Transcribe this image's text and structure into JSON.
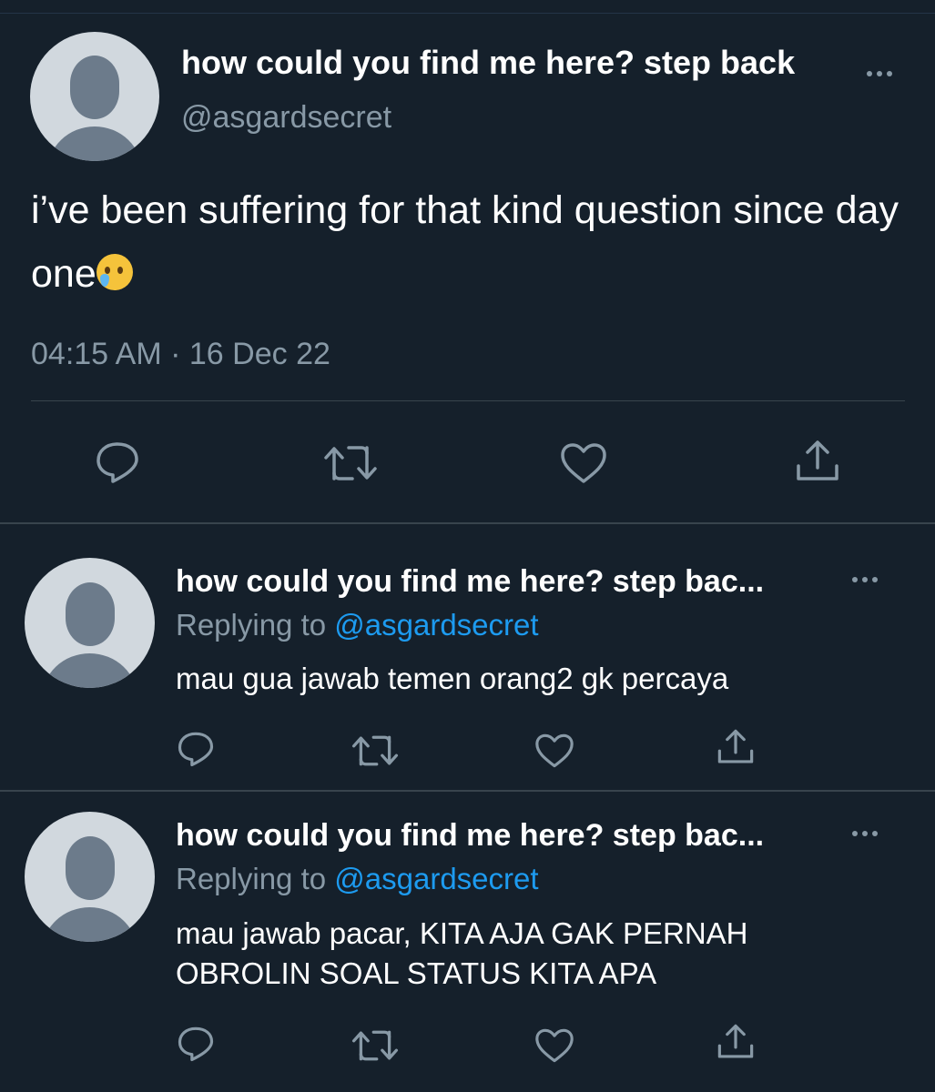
{
  "main_tweet": {
    "display_name": "how could you find me here? step back",
    "handle": "@asgardsecret",
    "text": "i’ve been suffering for that kind question since day one",
    "emoji_icon": "crying-face-emoji",
    "time": "04:15 AM",
    "separator": "·",
    "date": "16 Dec 22",
    "actions": [
      "reply-icon",
      "retweet-icon",
      "like-icon",
      "share-icon"
    ]
  },
  "replies": [
    {
      "display_name": "how could you find me here? step bac...",
      "replying_label": "Replying to",
      "replying_handle": "@asgardsecret",
      "text": "mau gua jawab temen orang2 gk percaya"
    },
    {
      "display_name": "how could you find me here? step bac...",
      "replying_label": "Replying to",
      "replying_handle": "@asgardsecret",
      "text": "mau jawab pacar, KITA AJA GAK PERNAH OBROLIN SOAL STATUS KITA APA"
    }
  ],
  "colors": {
    "background": "#15202b",
    "primary_text": "#ffffff",
    "secondary_text": "#8899a6",
    "mention": "#1d9bf0",
    "divider": "#38444d"
  }
}
